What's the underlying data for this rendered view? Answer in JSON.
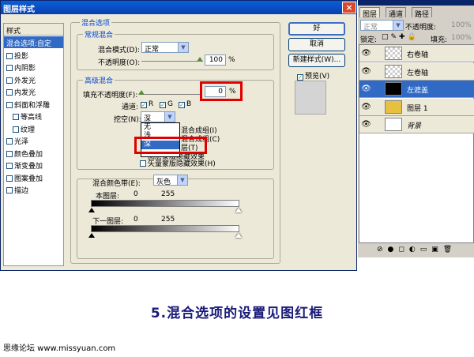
{
  "dialog": {
    "title": "图层样式",
    "close_glyph": "×",
    "styles_header": "样式",
    "styles": [
      {
        "label": "混合选项:自定",
        "selected": true,
        "checkbox": false,
        "indent": false
      },
      {
        "label": "投影",
        "checkbox": true,
        "indent": false
      },
      {
        "label": "内阴影",
        "checkbox": true,
        "indent": false
      },
      {
        "label": "外发光",
        "checkbox": true,
        "indent": false
      },
      {
        "label": "内发光",
        "checkbox": true,
        "indent": false
      },
      {
        "label": "斜面和浮雕",
        "checkbox": true,
        "indent": false
      },
      {
        "label": "等高线",
        "checkbox": true,
        "indent": true
      },
      {
        "label": "纹理",
        "checkbox": true,
        "indent": true
      },
      {
        "label": "光泽",
        "checkbox": true,
        "indent": false
      },
      {
        "label": "颜色叠加",
        "checkbox": true,
        "indent": false
      },
      {
        "label": "渐变叠加",
        "checkbox": true,
        "indent": false
      },
      {
        "label": "图案叠加",
        "checkbox": true,
        "indent": false
      },
      {
        "label": "描边",
        "checkbox": true,
        "indent": false
      }
    ],
    "blend_options": {
      "title": "混合选项",
      "general": {
        "title": "常规混合",
        "mode_label": "混合模式(D):",
        "mode_value": "正常",
        "opacity_label": "不透明度(O):",
        "opacity_value": "100",
        "opacity_fraction": 1.0,
        "unit": "%"
      },
      "advanced": {
        "title": "高级混合",
        "fill_label": "填充不透明度(F):",
        "fill_value": "0",
        "fill_fraction": 0.0,
        "unit": "%",
        "channels_label": "通道:",
        "channels": [
          "R",
          "G",
          "B"
        ],
        "knockout_label": "挖空(N):",
        "knockout_value": "深",
        "knockout_options": [
          "无",
          "浅",
          "深"
        ],
        "option_1": "将内部效果混合成组",
        "option_1_visible": "混合成组",
        "option_1_key": "(I)",
        "option_2_visible": "混合成组(C)",
        "option_3_visible": "层(T)",
        "option_4_visible": "图层蒙版隐藏效果",
        "option_5": "矢量蒙版隐藏效果(H)"
      },
      "blend_if": {
        "label": "混合颜色带(E):",
        "value": "灰色",
        "this_layer_label": "本图层:",
        "this_layer_min": "0",
        "this_layer_max": "255",
        "under_layer_label": "下一图层:",
        "under_layer_min": "0",
        "under_layer_max": "255"
      }
    },
    "buttons": {
      "ok": "好",
      "cancel": "取消",
      "new_style": "新建样式(W)...",
      "preview": "预览(V)"
    }
  },
  "layers_panel": {
    "tabs": [
      "图层",
      "通道",
      "路径"
    ],
    "blend_mode": "正常",
    "opacity_label": "不透明度:",
    "opacity_value": "100%",
    "lock_label": "锁定:",
    "fill_label": "填充:",
    "fill_value": "100%",
    "layers": [
      {
        "name": "右卷轴",
        "selected": false
      },
      {
        "name": "左卷轴",
        "selected": false
      },
      {
        "name": "左遮盖",
        "selected": true
      },
      {
        "name": "图层 1",
        "selected": false
      },
      {
        "name": "背景",
        "selected": false
      }
    ]
  },
  "caption": "5.混合选项的设置见图红框",
  "footer": "思缘论坛  www.missyuan.com",
  "colors": {
    "highlight": "#e00000",
    "selection": "#316ac5",
    "title": "#0a246a",
    "caption": "#1a1a7a"
  }
}
